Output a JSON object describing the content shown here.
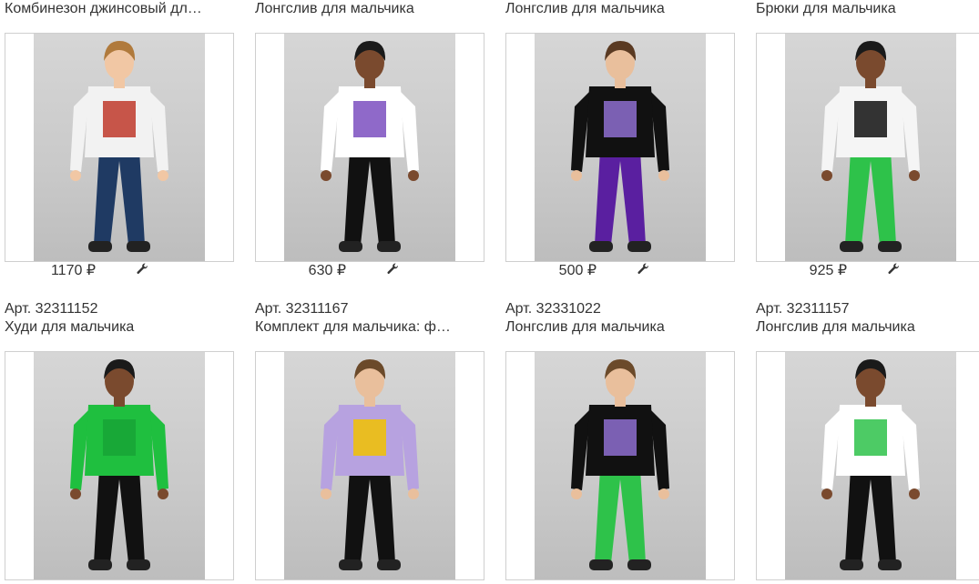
{
  "products": [
    {
      "title": "Комбинезон джинсовый дл…",
      "price": "1170 ₽",
      "art": "",
      "icon": "wrench-icon",
      "colors": {
        "top": "#f2f2f2",
        "bottom": "#1f3a63",
        "accent": "#c0392b",
        "hair": "#b07a3c",
        "skin": "#f1c7a4"
      }
    },
    {
      "title": "Лонгслив для мальчика",
      "price": "630 ₽",
      "art": "",
      "icon": "wrench-icon",
      "colors": {
        "top": "#ffffff",
        "bottom": "#111111",
        "accent": "#7b4fc0",
        "hair": "#1a1a1a",
        "skin": "#7a4a2e"
      }
    },
    {
      "title": "Лонгслив для мальчика",
      "price": "500 ₽",
      "art": "",
      "icon": "wrench-icon",
      "colors": {
        "top": "#111111",
        "bottom": "#5a1fa0",
        "accent": "#8e6fd0",
        "hair": "#5a3a22",
        "skin": "#e9bf9c"
      }
    },
    {
      "title": "Брюки для мальчика",
      "price": "925 ₽",
      "art": "",
      "icon": "wrench-icon",
      "colors": {
        "top": "#f5f5f5",
        "bottom": "#2ec24a",
        "accent": "#111111",
        "hair": "#1a1a1a",
        "skin": "#7a4a2e"
      }
    },
    {
      "title": "Худи для мальчика",
      "price": "",
      "art": "Арт. 32311152",
      "icon": "",
      "colors": {
        "top": "#1fbf3f",
        "bottom": "#111111",
        "accent": "#18a336",
        "hair": "#1a1a1a",
        "skin": "#7a4a2e"
      }
    },
    {
      "title": "Комплект для мальчика: ф…",
      "price": "",
      "art": "Арт. 32311167",
      "icon": "",
      "colors": {
        "top": "#b7a2e0",
        "bottom": "#111111",
        "accent": "#f2c200",
        "hair": "#6b4a2a",
        "skin": "#e9bf9c"
      }
    },
    {
      "title": "Лонгслив для мальчика",
      "price": "",
      "art": "Арт. 32331022",
      "icon": "",
      "colors": {
        "top": "#111111",
        "bottom": "#2ec24a",
        "accent": "#8e6fd0",
        "hair": "#6b4a2a",
        "skin": "#e9bf9c"
      }
    },
    {
      "title": "Лонгслив для мальчика",
      "price": "",
      "art": "Арт. 32311157",
      "icon": "",
      "colors": {
        "top": "#ffffff",
        "bottom": "#111111",
        "accent": "#2ec24a",
        "hair": "#1a1a1a",
        "skin": "#7a4a2e"
      }
    }
  ]
}
